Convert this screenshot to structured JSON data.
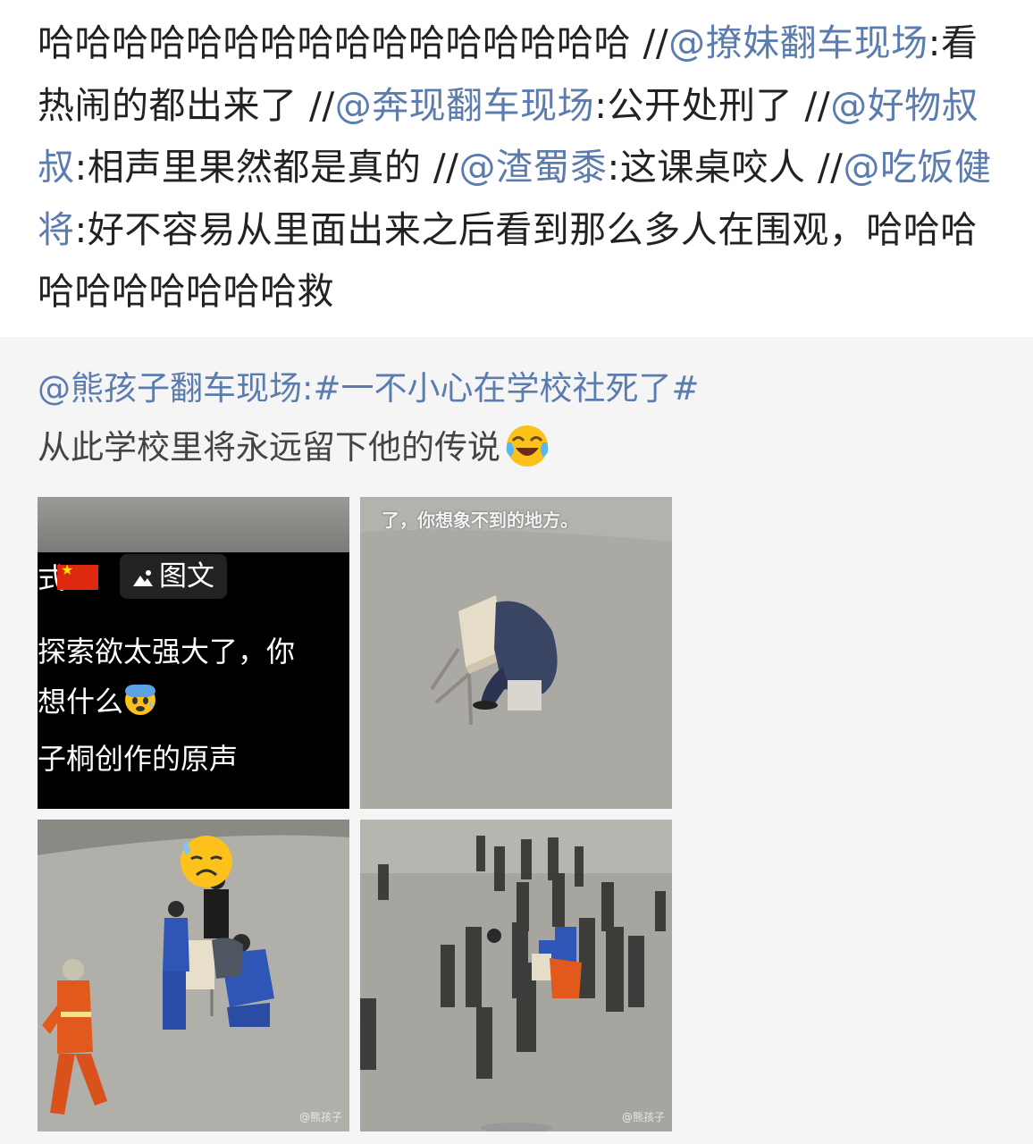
{
  "repost_chain": [
    {
      "type": "text",
      "text": "哈哈哈哈哈哈哈哈哈哈哈哈哈哈哈哈 "
    },
    {
      "type": "slash",
      "text": "//"
    },
    {
      "type": "mention",
      "text": "@撩妹翻车现场"
    },
    {
      "type": "text",
      "text": ":看热闹的都出来了 "
    },
    {
      "type": "slash",
      "text": "//"
    },
    {
      "type": "mention",
      "text": "@奔现翻车现场"
    },
    {
      "type": "text",
      "text": ":公开处刑了 "
    },
    {
      "type": "slash",
      "text": "//"
    },
    {
      "type": "mention",
      "text": "@好物叔叔"
    },
    {
      "type": "text",
      "text": ":相声里果然都是真的 "
    },
    {
      "type": "slash",
      "text": "//"
    },
    {
      "type": "mention",
      "text": "@渣蜀黍"
    },
    {
      "type": "text",
      "text": ":这课桌咬人 "
    },
    {
      "type": "slash",
      "text": "//"
    },
    {
      "type": "mention",
      "text": "@吃饭健将"
    },
    {
      "type": "text",
      "text": ":好不容易从里面出来之后看到那么多人在围观，哈哈哈哈哈哈哈哈哈哈救"
    }
  ],
  "original_post": {
    "author": "@熊孩子翻车现场",
    "text_line1": ":#一不小心在学校社死了#",
    "text_line2": "从此学校里将永远留下他的传说",
    "emoji": "laughing-crying-emoji"
  },
  "photos": {
    "p1": {
      "left_char": "式",
      "tag": "图文",
      "line1": "探索欲太强大了，你",
      "line2": "想什么",
      "line3": "子桐创作的原声"
    },
    "p2": {
      "caption": "了，你想象不到的地方。"
    },
    "p3": {
      "watermark": "@熊孩子"
    },
    "p4": {
      "watermark": "@熊孩子"
    }
  }
}
